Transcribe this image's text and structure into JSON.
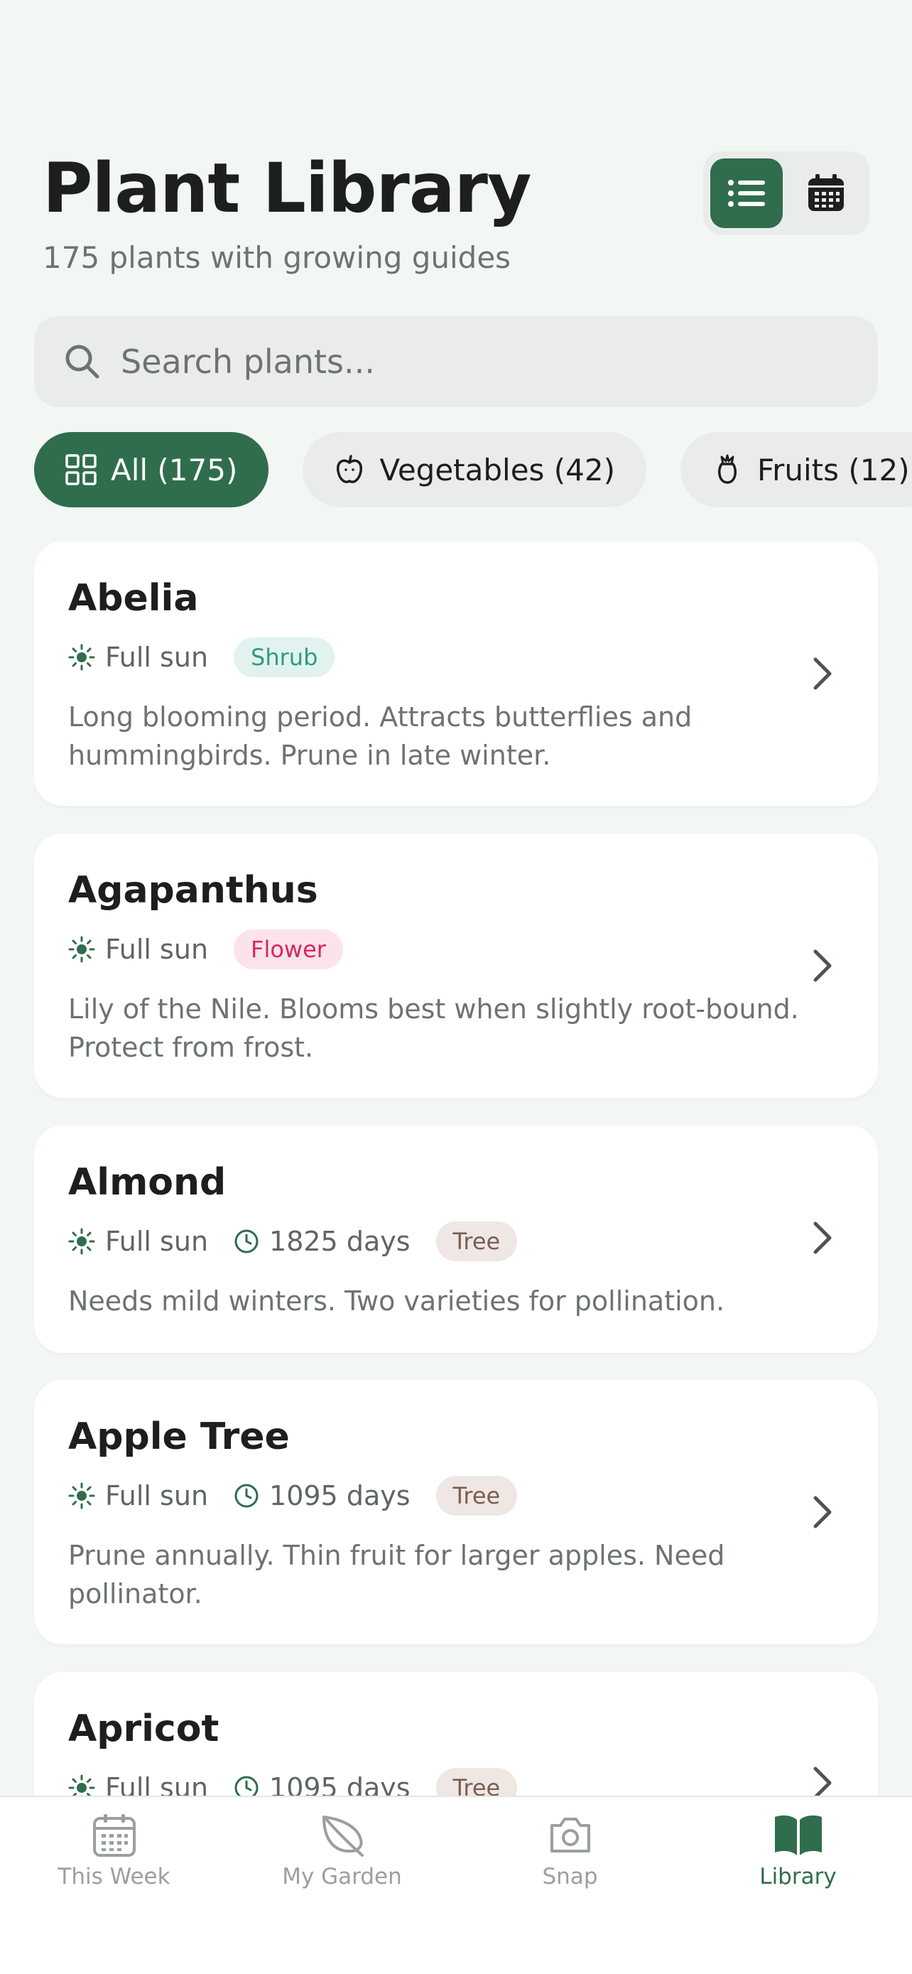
{
  "header": {
    "title": "Plant Library",
    "subtitle": "175 plants with growing guides"
  },
  "view_toggle": {
    "options": [
      "list-icon",
      "calendar-icon"
    ],
    "selected": "list"
  },
  "search": {
    "placeholder": "Search plants..."
  },
  "filters": [
    {
      "label": "All (175)",
      "icon": "grid-icon",
      "active": true
    },
    {
      "label": "Vegetables (42)",
      "icon": "apple-icon",
      "active": false
    },
    {
      "label": "Fruits (12)",
      "icon": "fruit-icon",
      "active": false
    }
  ],
  "plants": [
    {
      "name": "Abelia",
      "sun": "Full sun",
      "days": "",
      "category": "Shrub",
      "description": "Long blooming period. Attracts butterflies and hummingbirds. Prune in late winter."
    },
    {
      "name": "Agapanthus",
      "sun": "Full sun",
      "days": "",
      "category": "Flower",
      "description": "Lily of the Nile. Blooms best when slightly root-bound. Protect from frost."
    },
    {
      "name": "Almond",
      "sun": "Full sun",
      "days": "1825 days",
      "category": "Tree",
      "description": "Needs mild winters. Two varieties for pollination."
    },
    {
      "name": "Apple Tree",
      "sun": "Full sun",
      "days": "1095 days",
      "category": "Tree",
      "description": "Prune annually. Thin fruit for larger apples. Need pollinator."
    },
    {
      "name": "Apricot",
      "sun": "Full sun",
      "days": "1095 days",
      "category": "Tree",
      "description": ""
    }
  ],
  "nav": {
    "items": [
      {
        "label": "This Week",
        "icon": "calendar-icon"
      },
      {
        "label": "My Garden",
        "icon": "leaf-icon"
      },
      {
        "label": "Snap",
        "icon": "camera-icon"
      },
      {
        "label": "Library",
        "icon": "book-icon"
      }
    ],
    "active": "Library"
  },
  "colors": {
    "brand": "#2f6d4d",
    "background": "#f3f7f3",
    "shrub_badge": "#2e9a84",
    "flower_badge": "#d8265c",
    "tree_badge": "#7a5e52"
  }
}
